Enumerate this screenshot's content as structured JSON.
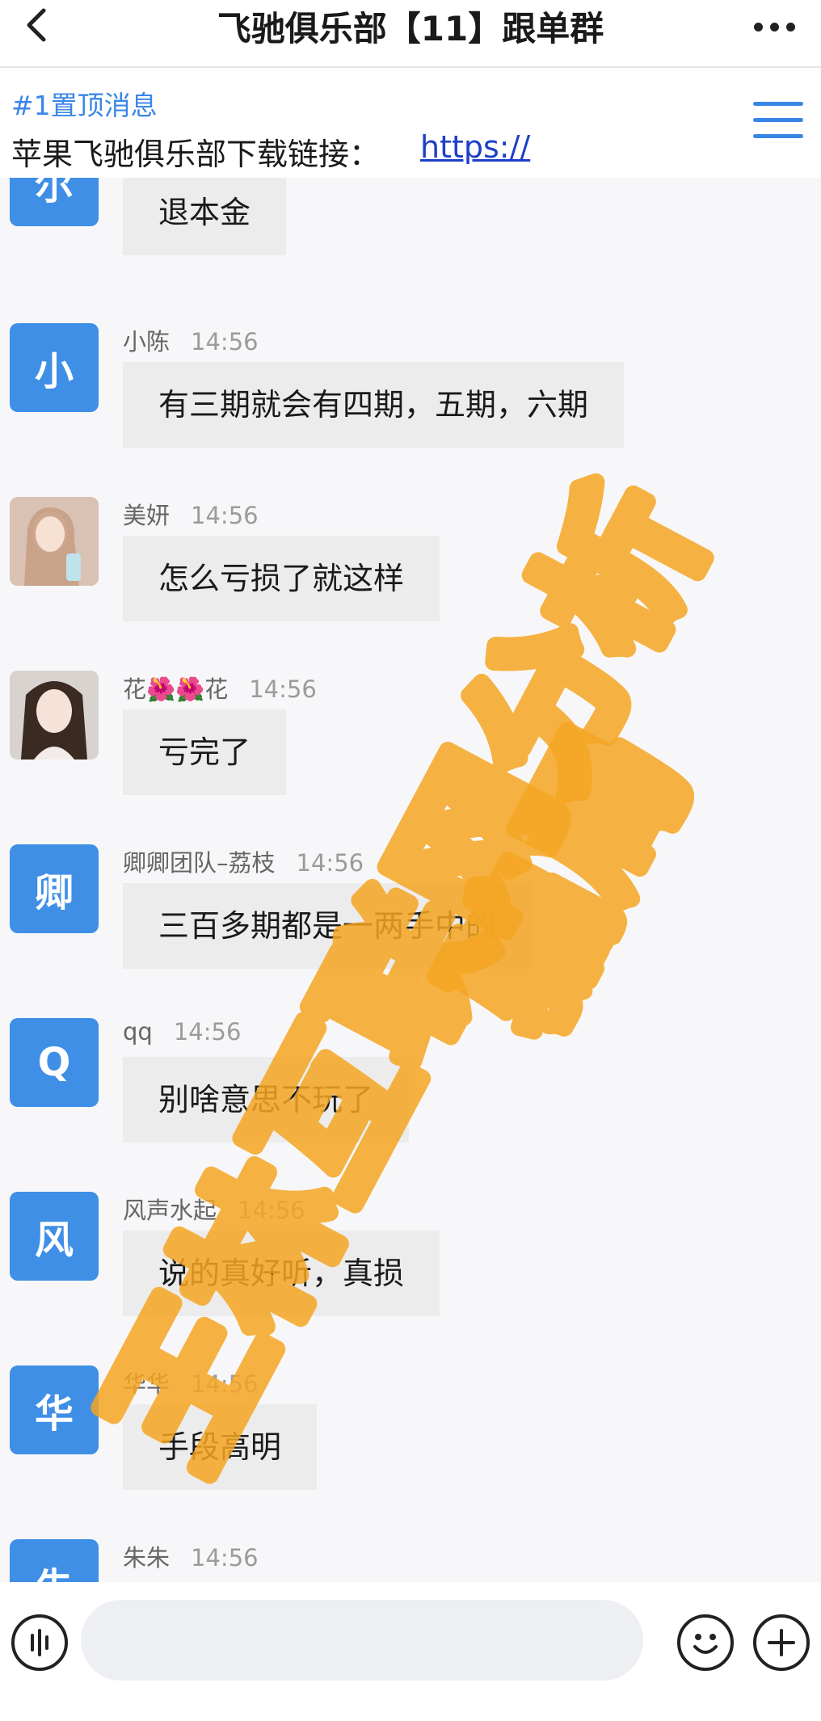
{
  "header": {
    "title": "飞驰俱乐部【11】跟单群",
    "back_icon": "chevron-left-icon",
    "more_icon": "more-dots-icon"
  },
  "pinned": {
    "tag": "#1置顶消息",
    "text": "苹果飞驰俱乐部下载链接：",
    "link": "https://",
    "menu_icon": "menu-icon"
  },
  "messages": [
    {
      "avatar_text": "尔",
      "sender": "",
      "time": "",
      "text": "退本金"
    },
    {
      "avatar_text": "小",
      "sender": "小陈",
      "time": "14:56",
      "text": "有三期就会有四期，五期，六期"
    },
    {
      "avatar_text": "",
      "sender": "美妍",
      "time": "14:56",
      "text": "怎么亏损了就这样"
    },
    {
      "avatar_text": "",
      "sender": "花🌺🌺花",
      "time": "14:56",
      "text": "亏完了"
    },
    {
      "avatar_text": "卿",
      "sender": "卿卿团队–荔枝",
      "time": "14:56",
      "text": "三百多期都是一两手中的"
    },
    {
      "avatar_text": "Q",
      "sender": "qq",
      "time": "14:56",
      "text": "别啥意思不玩了"
    },
    {
      "avatar_text": "风",
      "sender": "风声水起",
      "time": "14:56",
      "text": "说的真好听，真损"
    },
    {
      "avatar_text": "华",
      "sender": "华华",
      "time": "14:56",
      "text": "手段高明"
    },
    {
      "avatar_text": "朱",
      "sender": "朱朱",
      "time": "14:56",
      "text": ""
    }
  ],
  "footer": {
    "voice_icon": "voice-icon",
    "input_placeholder": "",
    "emoji_icon": "emoji-icon",
    "plus_icon": "plus-icon"
  },
  "watermark": {
    "line1": "王林互联网分析",
    "line2": "骗局",
    "color": "#f5a623"
  }
}
